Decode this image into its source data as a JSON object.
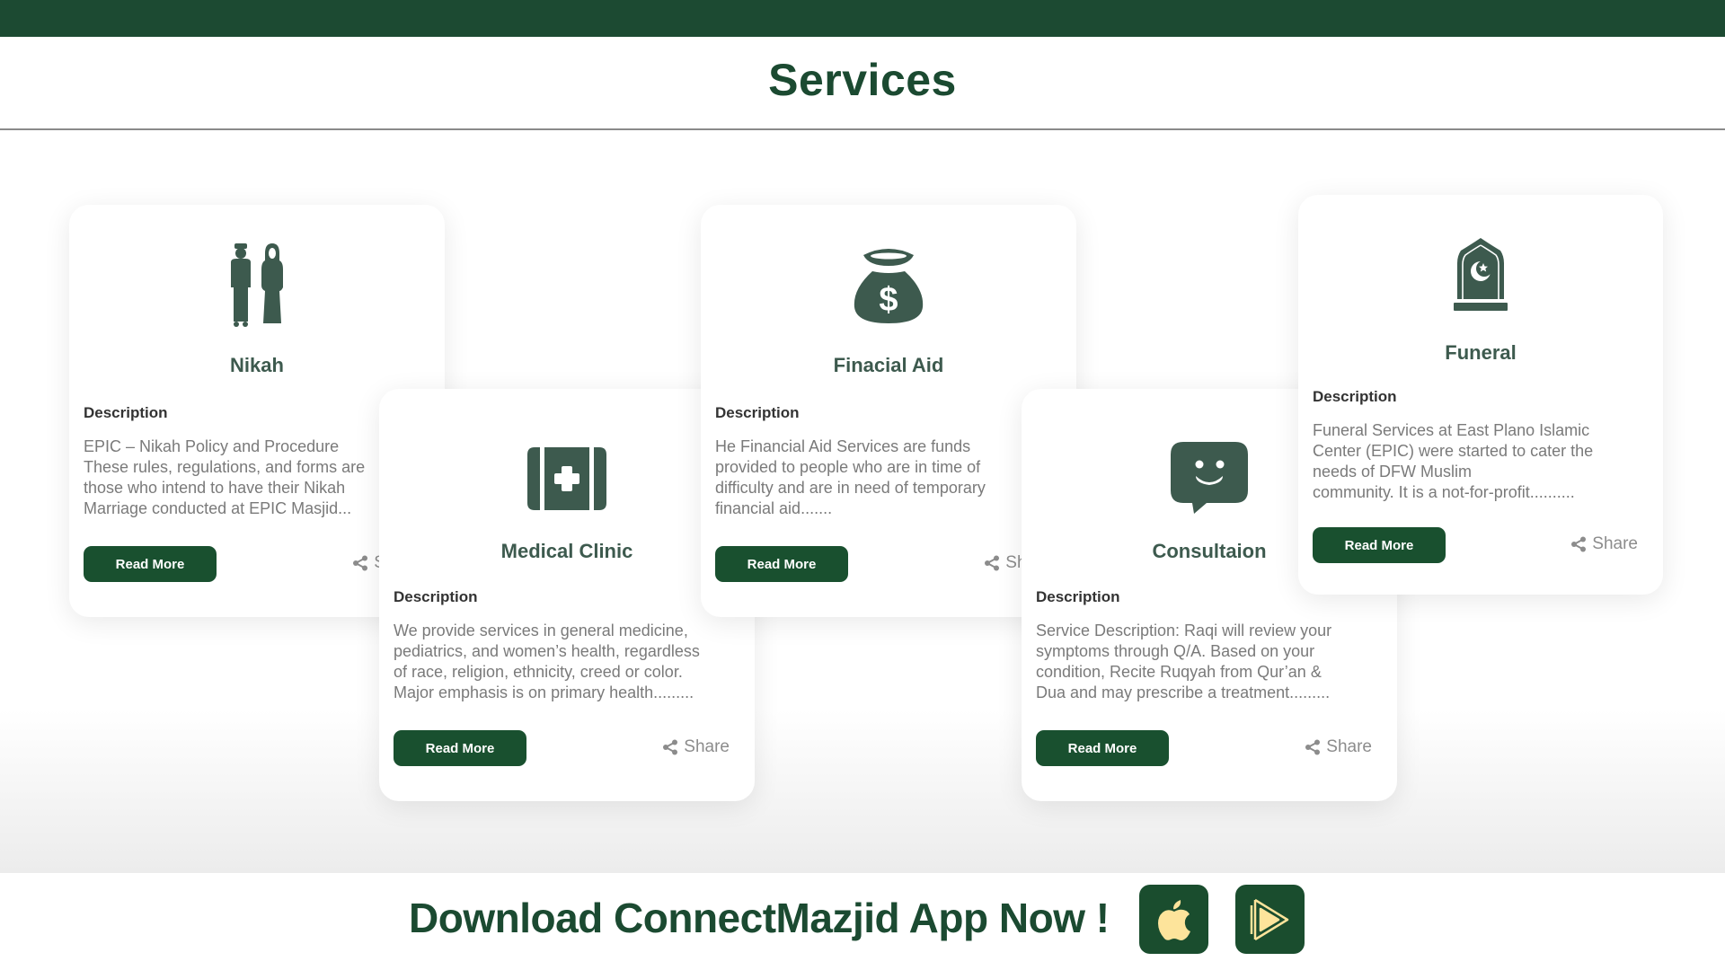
{
  "header": {
    "title": "Services"
  },
  "colors": {
    "primary": "#1c4a32",
    "button": "#19502f",
    "icon": "#3d5a4e",
    "store_glyph": "#fde49b"
  },
  "cards": [
    {
      "id": "nikah",
      "icon": "couple-icon",
      "title": "Nikah",
      "description_label": "Description",
      "description": "EPIC – Nikah Policy and Procedure\nThese rules, regulations, and forms are\nthose who intend to have their Nikah\nMarriage conducted at EPIC Masjid...",
      "read_more": "Read More",
      "share": "Share"
    },
    {
      "id": "medical",
      "icon": "medical-kit-icon",
      "title": "Medical Clinic",
      "description_label": "Description",
      "description": "We provide services in general medicine,\npediatrics, and women’s health, regardless\nof race, religion, ethnicity, creed or color.\nMajor emphasis is on primary health.........",
      "read_more": "Read More",
      "share": "Share"
    },
    {
      "id": "financial",
      "icon": "money-bag-icon",
      "title": "Finacial Aid",
      "description_label": "Description",
      "description": "He Financial Aid Services are funds\nprovided to people who are in time of\ndifficulty and are in need of temporary\nfinancial aid.......",
      "read_more": "Read More",
      "share": "Share"
    },
    {
      "id": "consult",
      "icon": "chat-smile-icon",
      "title": "Consultaion",
      "description_label": "Description",
      "description": "Service Description: Raqi will review your\nsymptoms through Q/A. Based on your\ncondition,  Recite Ruqyah from Qur’an &\nDua and may prescribe a treatment.........",
      "read_more": "Read More",
      "share": "Share"
    },
    {
      "id": "funeral",
      "icon": "tombstone-icon",
      "title": "Funeral",
      "description_label": "Description",
      "description": "Funeral Services at East Plano Islamic\nCenter (EPIC) were started to cater the\nneeds of DFW Muslim\ncommunity. It is a not-for-profit..........",
      "read_more": "Read More",
      "share": "Share"
    }
  ],
  "footer": {
    "download_text": "Download ConnectMazjid App Now !",
    "apple_store_icon": "apple-icon",
    "play_store_icon": "play-store-icon"
  }
}
